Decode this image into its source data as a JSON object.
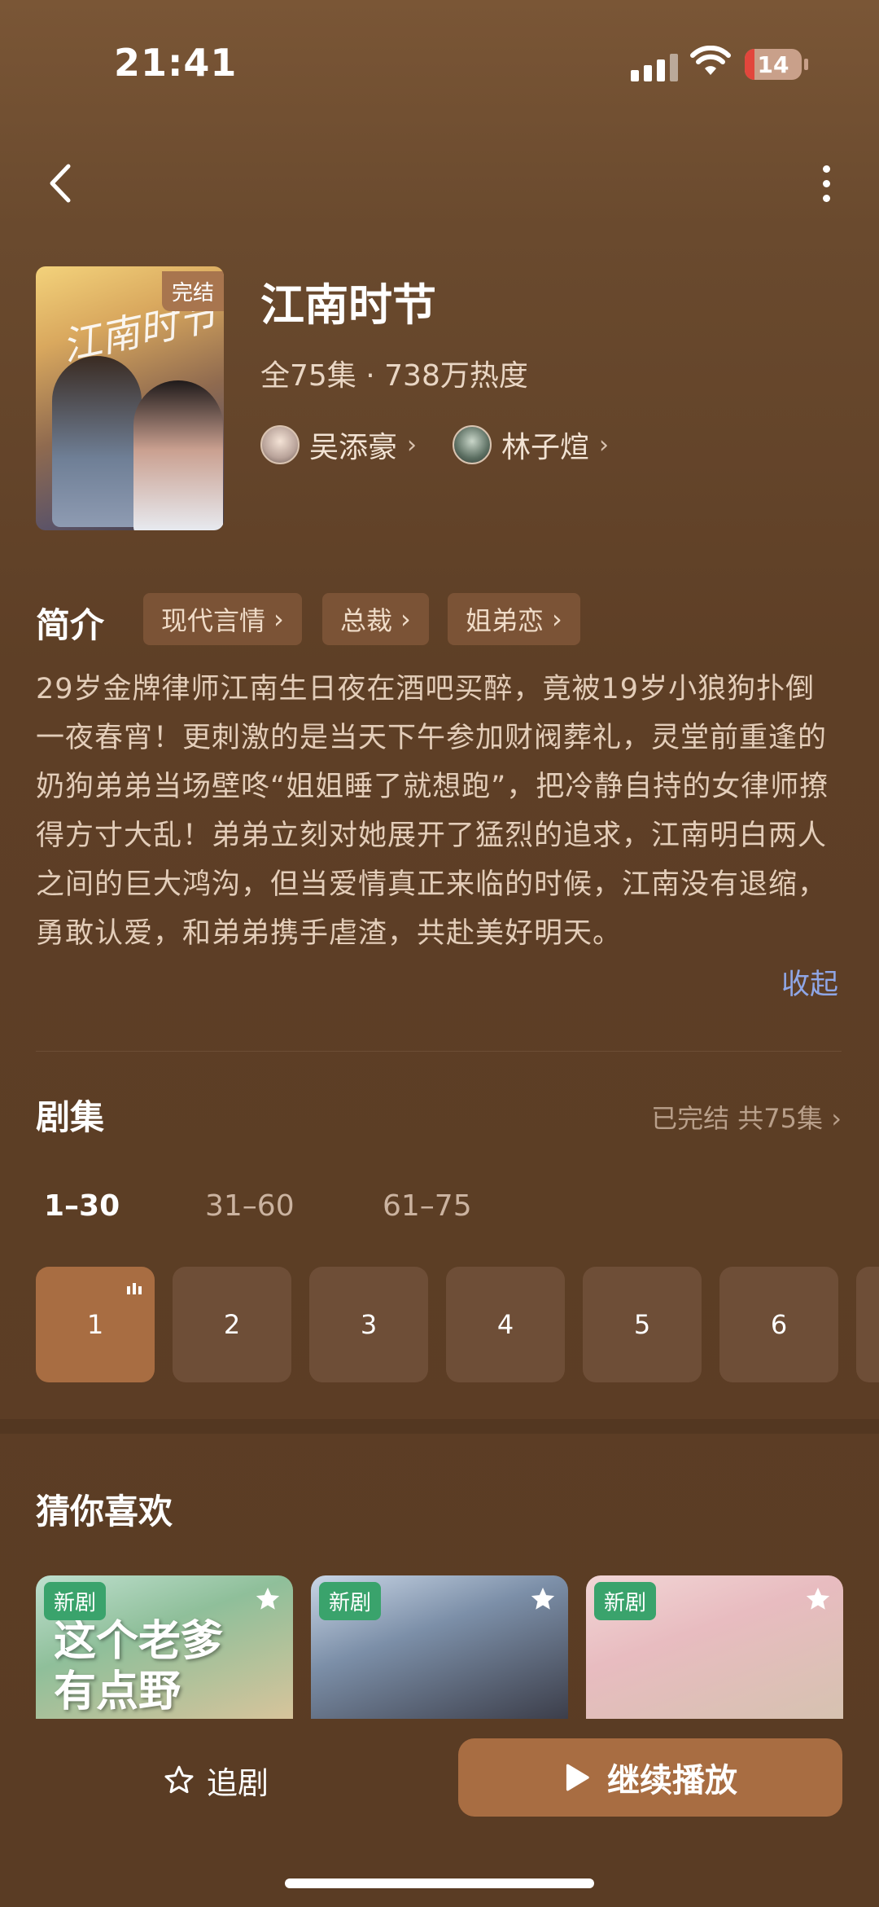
{
  "status": {
    "time": "21:41",
    "battery": "14"
  },
  "drama": {
    "badge": "完结",
    "title": "江南时节",
    "meta": "全75集 · 738万热度",
    "actors": [
      {
        "name": "吴添豪"
      },
      {
        "name": "林子煊"
      }
    ]
  },
  "intro": {
    "label": "简介",
    "tags": [
      "现代言情",
      "总裁",
      "姐弟恋"
    ],
    "text": "29岁金牌律师江南生日夜在酒吧买醉，竟被19岁小狼狗扑倒一夜春宵！更刺激的是当天下午参加财阀葬礼，灵堂前重逢的奶狗弟弟当场壁咚“姐姐睡了就想跑”，把冷静自持的女律师撩得方寸大乱！弟弟立刻对她展开了猛烈的追求，江南明白两人之间的巨大鸿沟，但当爱情真正来临的时候，江南没有退缩，勇敢认爱，和弟弟携手虐渣，共赴美好明天。",
    "collapse": "收起"
  },
  "episodes": {
    "label": "剧集",
    "status": "已完结 共75集",
    "ranges": [
      "1–30",
      "31–60",
      "61–75"
    ],
    "items": [
      "1",
      "2",
      "3",
      "4",
      "5",
      "6"
    ]
  },
  "recommend": {
    "label": "猜你喜欢",
    "cards": [
      {
        "badge": "新剧",
        "caption1": "这个老爹",
        "caption2": "有点野"
      },
      {
        "badge": "新剧"
      },
      {
        "badge": "新剧"
      }
    ]
  },
  "actions": {
    "follow": "追剧",
    "play": "继续播放"
  }
}
